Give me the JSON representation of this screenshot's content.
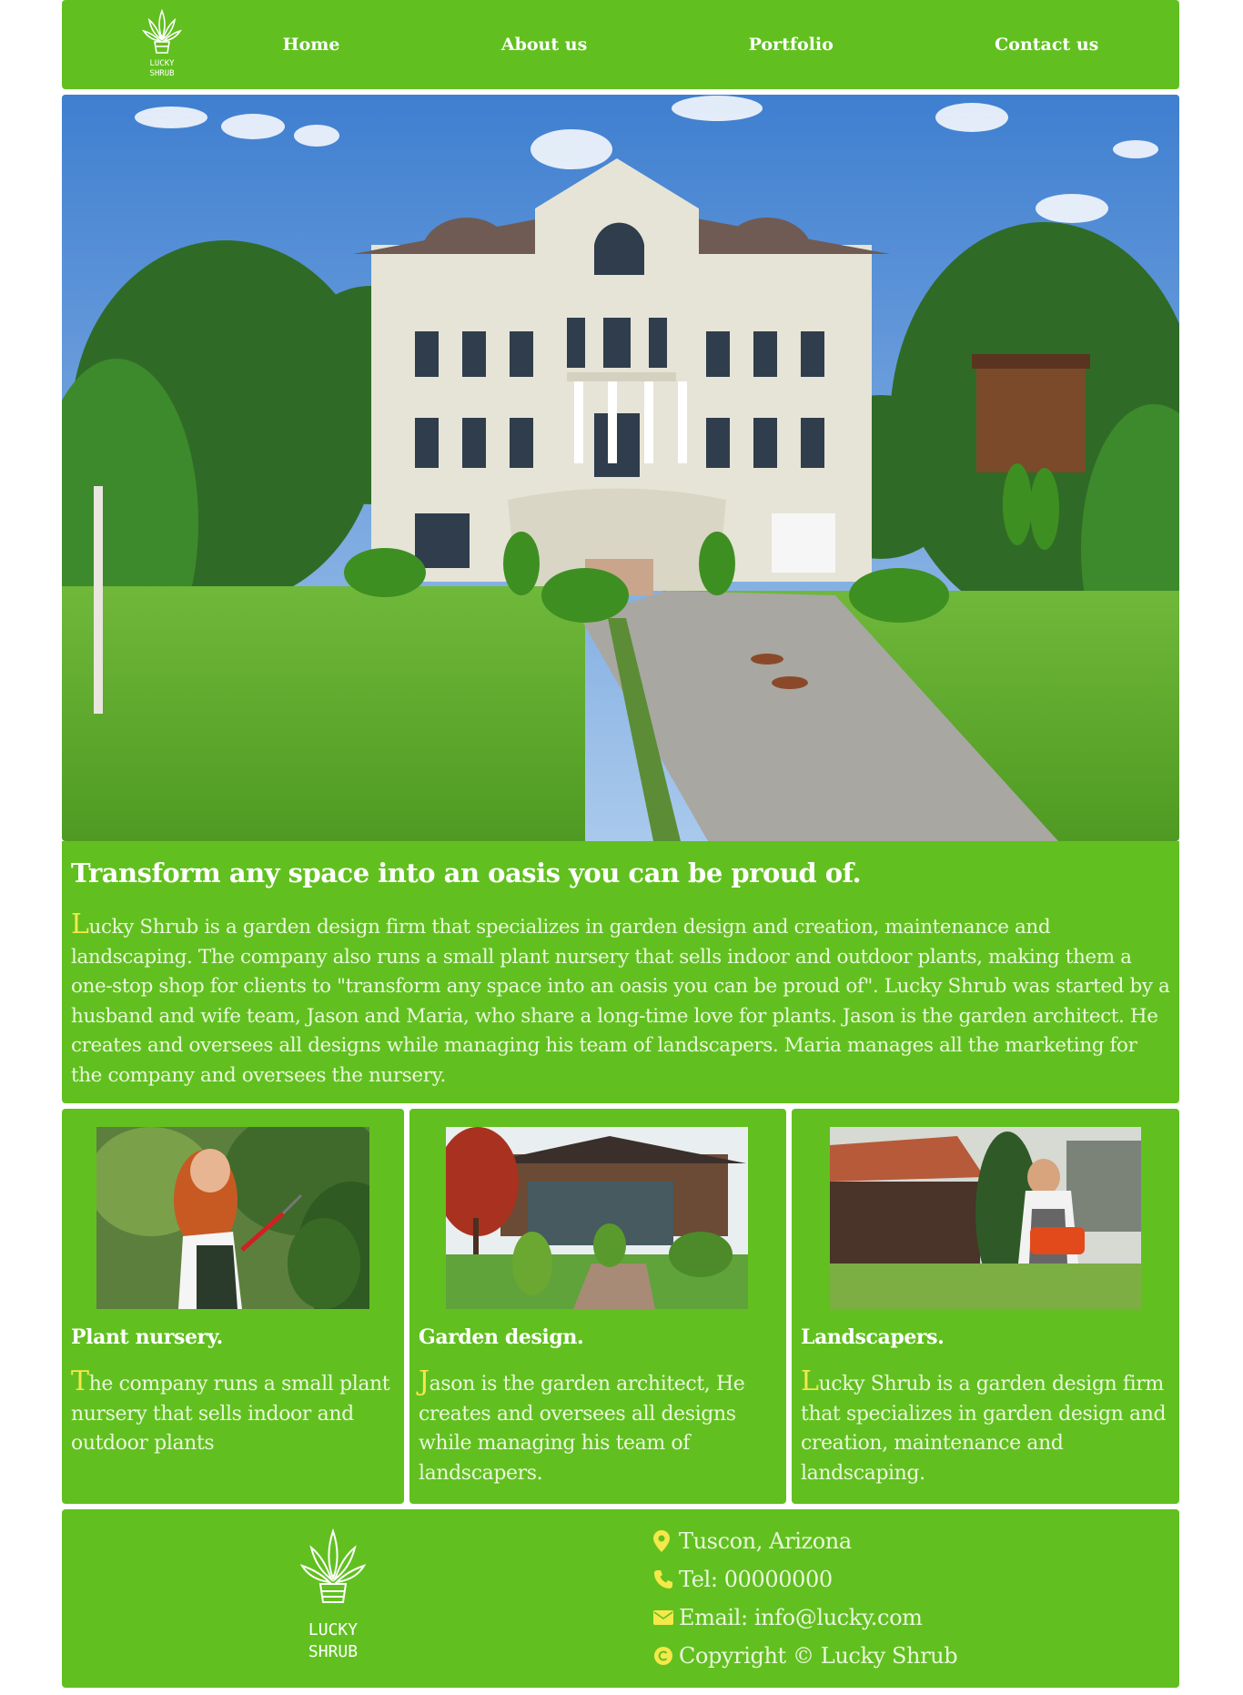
{
  "colors": {
    "brand_green": "#61c01f",
    "accent_yellow": "#f5e84a",
    "text_light": "#eaf6dc"
  },
  "brand": {
    "logo_text_line1": "LUCKY",
    "logo_text_line2": "SHRUB"
  },
  "nav": {
    "items": [
      {
        "label": "Home"
      },
      {
        "label": "About us"
      },
      {
        "label": "Portfolio"
      },
      {
        "label": "Contact us"
      }
    ]
  },
  "hero": {
    "image": "mansion-with-garden-photo"
  },
  "intro": {
    "heading": "Transform any space into an oasis you can be proud of.",
    "dropcap": "L",
    "body": "ucky Shrub is a garden design firm that specializes in garden design and creation, maintenance and landscaping. The company also runs a small plant nursery that sells indoor and outdoor plants, making them a one-stop shop for clients to \"transform any space into an oasis you can be proud of\". Lucky Shrub was started by a husband and wife team, Jason and Maria, who share a long-time love for plants. Jason is the garden architect. He creates and oversees all designs while managing his team of landscapers. Maria manages all the marketing for the company and oversees the nursery."
  },
  "cards": [
    {
      "title": "Plant nursery.",
      "dropcap": "T",
      "body": "he company runs a small plant nursery that sells indoor and outdoor plants",
      "image": "woman-pruning-shrub-photo"
    },
    {
      "title": "Garden design.",
      "dropcap": "J",
      "body": "ason is the garden architect, He creates and oversees all designs while managing his team of landscapers.",
      "image": "house-garden-photo"
    },
    {
      "title": "Landscapers.",
      "dropcap": "L",
      "body": "ucky Shrub is a garden design firm that specializes in garden design and creation, maintenance and landscaping.",
      "image": "man-hedge-trimmer-photo"
    }
  ],
  "footer": {
    "location": "Tuscon, Arizona",
    "tel": "Tel: 00000000",
    "email": "Email: info@lucky.com",
    "copyright": "Copyright © Lucky Shrub",
    "icons": [
      "map-pin-icon",
      "phone-icon",
      "envelope-icon",
      "copyright-icon"
    ]
  }
}
